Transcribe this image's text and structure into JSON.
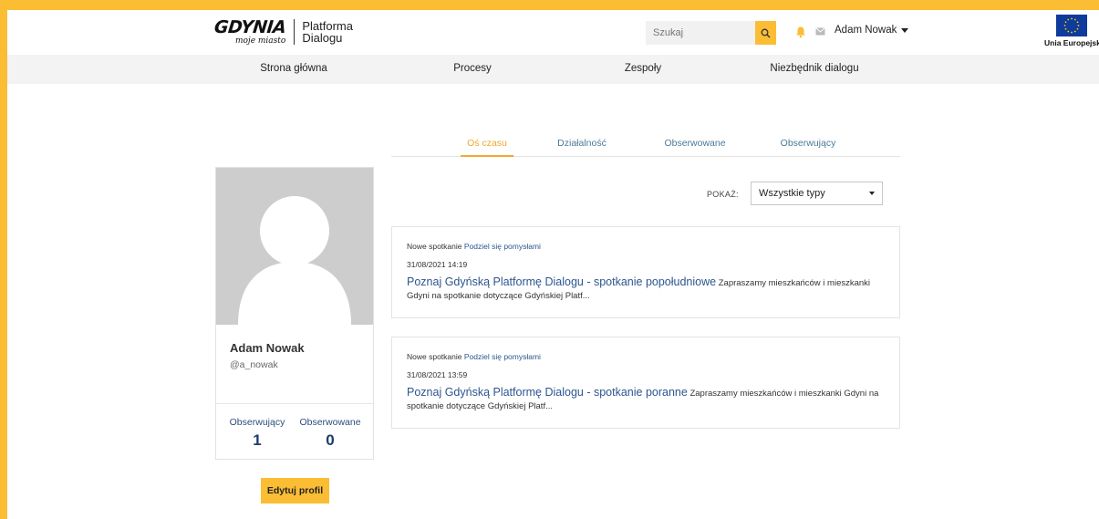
{
  "header": {
    "logo_main": "GDYNIA",
    "logo_sub": "moje miasto",
    "platform_line1": "Platforma",
    "platform_line2": "Dialogu",
    "search_placeholder": "Szukaj",
    "user_name": "Adam Nowak",
    "eu_label": "Unia Europejska",
    "icons": [
      "search-icon",
      "bell-icon",
      "mail-icon",
      "caret-down-icon",
      "eu-flag-icon"
    ]
  },
  "nav": {
    "items": [
      {
        "label": "Strona główna"
      },
      {
        "label": "Procesy"
      },
      {
        "label": "Zespoły"
      },
      {
        "label": "Niezbędnik dialogu"
      }
    ]
  },
  "profile": {
    "name": "Adam Nowak",
    "handle": "@a_nowak",
    "followers_label": "Obserwujący",
    "followers_count": "1",
    "following_label": "Obserwowane",
    "following_count": "0",
    "edit_label": "Edytuj profil"
  },
  "tabs": [
    {
      "label": "Oś czasu",
      "active": true
    },
    {
      "label": "Działalność",
      "active": false
    },
    {
      "label": "Obserwowane",
      "active": false
    },
    {
      "label": "Obserwujący",
      "active": false
    }
  ],
  "filter": {
    "label": "POKAŻ:",
    "selected": "Wszystkie typy"
  },
  "feed": [
    {
      "type": "Nowe spotkanie",
      "group": "Podziel się pomysłami",
      "date": "31/08/2021 14:19",
      "title": "Poznaj Gdyńską Platformę Dialogu - spotkanie popołudniowe",
      "excerpt": "Zapraszamy mieszkańców i mieszkanki Gdyni na spotkanie dotyczące Gdyńskiej Platf..."
    },
    {
      "type": "Nowe spotkanie",
      "group": "Podziel się pomysłami",
      "date": "31/08/2021 13:59",
      "title": "Poznaj Gdyńską Platformę Dialogu - spotkanie poranne",
      "excerpt": "Zapraszamy mieszkańców i mieszkanki Gdyni na spotkanie dotyczące Gdyńskiej Platf..."
    }
  ],
  "colors": {
    "accent": "#fbbd34",
    "link": "#2d5590",
    "tab_active": "#f0a830",
    "tab_inactive": "#4a7a9a",
    "eu_blue": "#0e3b9c",
    "eu_star": "#ffcc00"
  }
}
